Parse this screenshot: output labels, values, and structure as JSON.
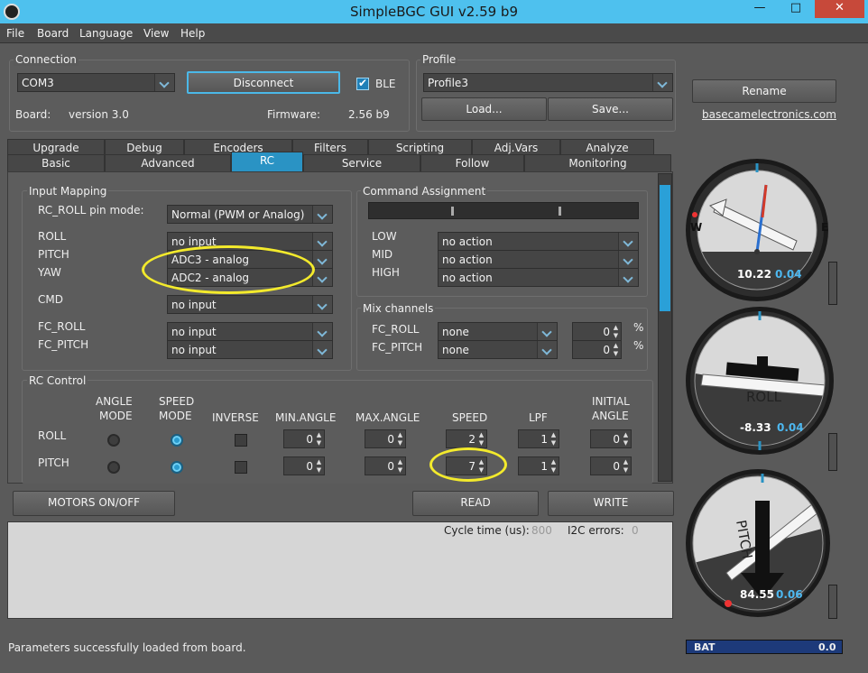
{
  "window": {
    "title": "SimpleBGC GUI v2.59 b9",
    "minimize": "—",
    "maximize": "□",
    "close": "✕"
  },
  "menu": [
    "File",
    "Board",
    "Language",
    "View",
    "Help"
  ],
  "connection": {
    "title": "Connection",
    "port": "COM3",
    "disconnect": "Disconnect",
    "ble_label": "BLE",
    "ble_checked": true,
    "board_label": "Board:",
    "board_value": "version 3.0",
    "firmware_label": "Firmware:",
    "firmware_value": "2.56 b9"
  },
  "profile": {
    "title": "Profile",
    "selected": "Profile3",
    "load": "Load...",
    "save": "Save..."
  },
  "rename": "Rename",
  "website": "basecamelectronics.com",
  "tabs_top": [
    "Upgrade",
    "Debug",
    "Encoders",
    "Filters",
    "Scripting",
    "Adj.Vars",
    "Analyze"
  ],
  "tabs_bottom": [
    "Basic",
    "Advanced",
    "RC",
    "Service",
    "Follow",
    "Monitoring"
  ],
  "tab_selected": "RC",
  "input_mapping": {
    "title": "Input Mapping",
    "pin_mode_label": "RC_ROLL pin mode:",
    "pin_mode_value": "Normal (PWM or Analog)",
    "rows": [
      {
        "label": "ROLL",
        "value": "no input"
      },
      {
        "label": "PITCH",
        "value": "ADC3 - analog"
      },
      {
        "label": "YAW",
        "value": "ADC2 - analog"
      },
      {
        "label": "CMD",
        "value": "no input"
      },
      {
        "label": "FC_ROLL",
        "value": "no input"
      },
      {
        "label": "FC_PITCH",
        "value": "no input"
      }
    ]
  },
  "command_assignment": {
    "title": "Command Assignment",
    "rows": [
      {
        "label": "LOW",
        "value": "no action"
      },
      {
        "label": "MID",
        "value": "no action"
      },
      {
        "label": "HIGH",
        "value": "no action"
      }
    ]
  },
  "mix_channels": {
    "title": "Mix channels",
    "rows": [
      {
        "label": "FC_ROLL",
        "value": "none",
        "pct": "0",
        "unit": "%"
      },
      {
        "label": "FC_PITCH",
        "value": "none",
        "pct": "0",
        "unit": "%"
      }
    ]
  },
  "rc_control": {
    "title": "RC Control",
    "headers": {
      "angle_mode": [
        "ANGLE",
        "MODE"
      ],
      "speed_mode": [
        "SPEED",
        "MODE"
      ],
      "inverse": "INVERSE",
      "min_angle": "MIN.ANGLE",
      "max_angle": "MAX.ANGLE",
      "speed": "SPEED",
      "lpf": "LPF",
      "initial_angle": [
        "INITIAL",
        "ANGLE"
      ]
    },
    "rows": [
      {
        "label": "ROLL",
        "mode": "speed",
        "inverse": false,
        "min_angle": "0",
        "max_angle": "0",
        "speed": "2",
        "lpf": "1",
        "initial_angle": "0"
      },
      {
        "label": "PITCH",
        "mode": "speed",
        "inverse": false,
        "min_angle": "0",
        "max_angle": "0",
        "speed": "7",
        "lpf": "1",
        "initial_angle": "0"
      }
    ]
  },
  "buttons": {
    "motors": "MOTORS ON/OFF",
    "read": "READ",
    "write": "WRITE"
  },
  "stats": {
    "cycle_label": "Cycle time (us):",
    "cycle_value": "800",
    "i2c_label": "I2C errors:",
    "i2c_value": "0"
  },
  "status": {
    "message": "Parameters successfully loaded from board.",
    "bat_label": "BAT",
    "bat_value": "0.0"
  },
  "gauges": {
    "yaw": {
      "value": "10.22",
      "rate": "0.04",
      "west": "W",
      "east": "E"
    },
    "roll": {
      "label": "ROLL",
      "value": "-8.33",
      "rate": "0.04"
    },
    "pitch": {
      "label": "PITCH",
      "value": "84.55",
      "rate": "0.06"
    }
  },
  "colors": {
    "accent": "#2a93c4",
    "highlight": "#f3ea2c"
  }
}
